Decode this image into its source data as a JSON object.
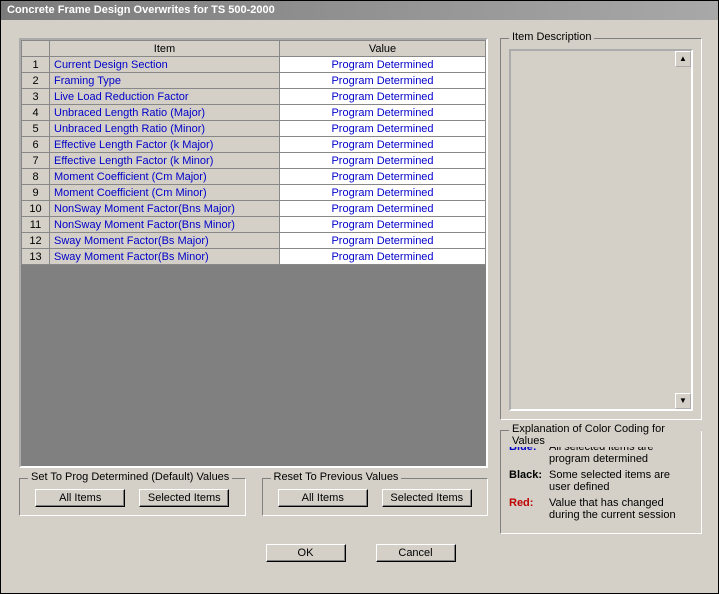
{
  "window": {
    "title": "Concrete Frame Design Overwrites for TS 500-2000"
  },
  "grid": {
    "headers": {
      "item": "Item",
      "value": "Value"
    },
    "rows": [
      {
        "n": "1",
        "item": "Current Design Section",
        "value": "Program Determined"
      },
      {
        "n": "2",
        "item": "Framing Type",
        "value": "Program Determined"
      },
      {
        "n": "3",
        "item": "Live Load Reduction Factor",
        "value": "Program Determined"
      },
      {
        "n": "4",
        "item": "Unbraced Length Ratio (Major)",
        "value": "Program Determined"
      },
      {
        "n": "5",
        "item": "Unbraced Length Ratio (Minor)",
        "value": "Program Determined"
      },
      {
        "n": "6",
        "item": "Effective Length Factor (k Major)",
        "value": "Program Determined"
      },
      {
        "n": "7",
        "item": "Effective Length Factor (k Minor)",
        "value": "Program Determined"
      },
      {
        "n": "8",
        "item": "Moment Coefficient (Cm Major)",
        "value": "Program Determined"
      },
      {
        "n": "9",
        "item": "Moment Coefficient (Cm Minor)",
        "value": "Program Determined"
      },
      {
        "n": "10",
        "item": "NonSway Moment Factor(Bns Major)",
        "value": "Program Determined"
      },
      {
        "n": "11",
        "item": "NonSway Moment Factor(Bns Minor)",
        "value": "Program Determined"
      },
      {
        "n": "12",
        "item": "Sway Moment Factor(Bs Major)",
        "value": "Program Determined"
      },
      {
        "n": "13",
        "item": "Sway Moment Factor(Bs Minor)",
        "value": "Program Determined"
      }
    ]
  },
  "item_description": {
    "title": "Item Description",
    "text": ""
  },
  "explanation": {
    "title": "Explanation of Color Coding for Values",
    "rows": [
      {
        "label": "Blue:",
        "text": "All selected items are program determined",
        "color": "blue"
      },
      {
        "label": "Black:",
        "text": "Some selected items are user defined",
        "color": "black"
      },
      {
        "label": "Red:",
        "text": "Value that has changed during the current session",
        "color": "red"
      }
    ]
  },
  "set_prog": {
    "title": "Set To Prog Determined (Default) Values",
    "all": "All Items",
    "selected": "Selected Items"
  },
  "reset_prev": {
    "title": "Reset To Previous Values",
    "all": "All Items",
    "selected": "Selected Items"
  },
  "buttons": {
    "ok": "OK",
    "cancel": "Cancel"
  }
}
